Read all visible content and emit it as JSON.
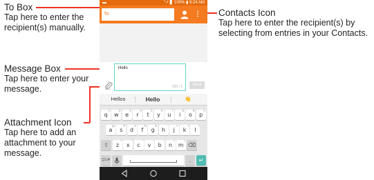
{
  "callouts": {
    "to_box": {
      "title": "To Box",
      "description": "Tap here to enter the recipient(s) manually."
    },
    "message_box": {
      "title": "Message Box",
      "description": "Tap here to enter your message."
    },
    "attachment_icon": {
      "title": "Attachment Icon",
      "description": "Tap here to add an attachment to your message."
    },
    "contacts_icon": {
      "title": "Contacts Icon",
      "description": "Tap here to enter the recipient(s) by selecting from entries in your Contacts."
    }
  },
  "phone": {
    "status_bar": {
      "info": "“↗ ▋ 100% ▮ 9:24 AM"
    },
    "app_bar": {
      "to_label": "To",
      "contacts_icon": "person-icon",
      "more_icon": "overflow-menu-icon"
    },
    "compose": {
      "message_text": "Hello",
      "char_count": "155 / 1",
      "send_label": "Send",
      "attach_icon": "paperclip-icon"
    },
    "keyboard": {
      "suggestions": [
        "Hellos",
        "Hello",
        "👋"
      ],
      "rows": [
        [
          {
            "label": "q",
            "sup": "1"
          },
          {
            "label": "w",
            "sup": "2"
          },
          {
            "label": "e",
            "sup": "3"
          },
          {
            "label": "r",
            "sup": "4"
          },
          {
            "label": "t",
            "sup": "5"
          },
          {
            "label": "y",
            "sup": "6"
          },
          {
            "label": "u",
            "sup": "7"
          },
          {
            "label": "i",
            "sup": "8"
          },
          {
            "label": "o",
            "sup": "9"
          },
          {
            "label": "p",
            "sup": "0"
          }
        ],
        [
          {
            "label": "a",
            "sup": "@"
          },
          {
            "label": "s",
            "sup": "#"
          },
          {
            "label": "d",
            "sup": "$"
          },
          {
            "label": "f",
            "sup": "%"
          },
          {
            "label": "g",
            "sup": "&"
          },
          {
            "label": "h",
            "sup": "-"
          },
          {
            "label": "j",
            "sup": "+"
          },
          {
            "label": "k",
            "sup": "("
          },
          {
            "label": "l",
            "sup": ")"
          }
        ],
        [
          {
            "label": "⇧",
            "kind": "shift"
          },
          {
            "label": "z",
            "sup": "*"
          },
          {
            "label": "x",
            "sup": "\""
          },
          {
            "label": "c",
            "sup": "'"
          },
          {
            "label": "v",
            "sup": ":"
          },
          {
            "label": "b",
            "sup": ";"
          },
          {
            "label": "n",
            "sup": "!"
          },
          {
            "label": "m",
            "sup": "?"
          },
          {
            "label": "⌫",
            "kind": "backspace"
          }
        ]
      ],
      "bottom_row": {
        "symbols_label": "☺1#",
        "mic_icon": "microphone-icon",
        "space_sup": "..",
        "period_label": ".",
        "enter_label": "↵"
      }
    },
    "nav_bar": {
      "back_icon": "back-triangle-icon",
      "home_icon": "home-circle-icon",
      "recents_icon": "recents-square-icon"
    }
  },
  "colors": {
    "accent": "#f47b20",
    "status_bar": "#e56a0b",
    "callout_line": "#ee3124",
    "message_border": "#5fd4c9",
    "teal_key": "#50bdb2"
  }
}
